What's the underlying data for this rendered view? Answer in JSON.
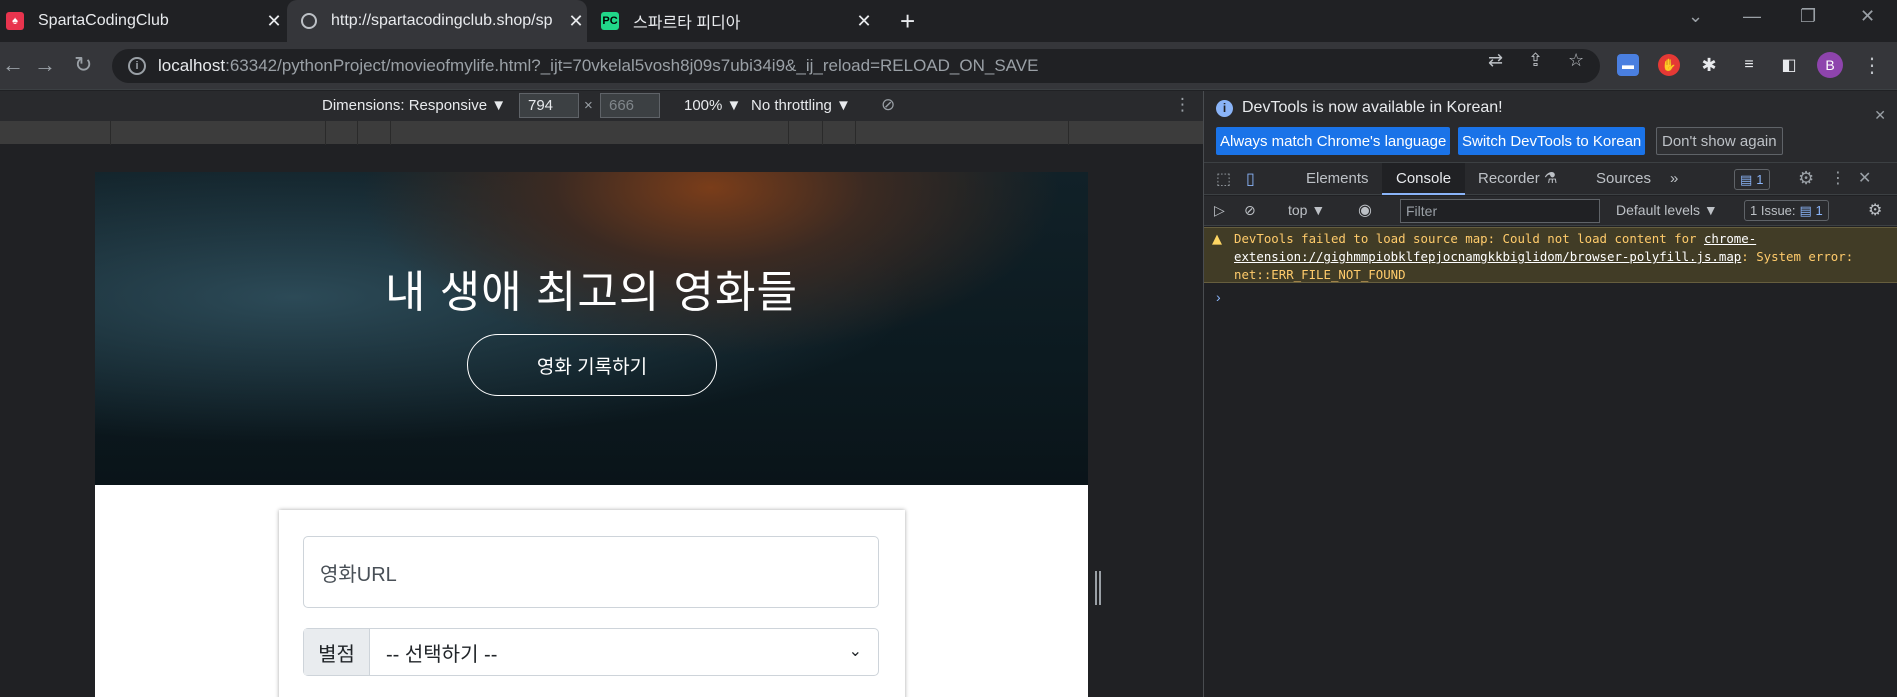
{
  "browser": {
    "tabs": [
      {
        "title": "SpartaCodingClub",
        "active": false,
        "icon": "sparta-icon"
      },
      {
        "title": "http://spartacodingclub.shop/sp",
        "active": true,
        "icon": "globe-icon"
      },
      {
        "title": "스파르타 피디아",
        "active": false,
        "icon": "pycharm-icon"
      }
    ],
    "address": {
      "host": "localhost",
      "path": ":63342/pythonProject/movieofmylife.html?_ijt=70vkelal5vosh8j09s7ubi34i9&_ij_reload=RELOAD_ON_SAVE"
    },
    "avatar_letter": "B"
  },
  "device_toolbar": {
    "dimensions": "Dimensions: Responsive ▼",
    "width": "794",
    "height": "666",
    "zoom": "100% ▼",
    "throttling": "No throttling ▼"
  },
  "page": {
    "hero_title": "내 생애 최고의 영화들",
    "record_button": "영화 기록하기",
    "url_placeholder": "영화URL",
    "star_label": "별점",
    "star_select": "-- 선택하기 --"
  },
  "devtools": {
    "info_message": "DevTools is now available in Korean!",
    "btn_match": "Always match Chrome's language",
    "btn_switch": "Switch DevTools to Korean",
    "btn_dont_show": "Don't show again",
    "tabs": [
      "Elements",
      "Console",
      "Recorder",
      "Sources"
    ],
    "issues_count": "1",
    "context": "top",
    "filter_placeholder": "Filter",
    "levels": "Default levels",
    "issue_label": "1 Issue:",
    "issue_count": "1",
    "warning": {
      "prefix": "DevTools failed to load source map: Could not load content for ",
      "link": "chrome-extension://gighmmpiobklfepjocnamgkkbiglidom/browser-polyfill.js.map",
      "suffix": ": System error: net::ERR_FILE_NOT_FOUND"
    },
    "prompt": "›"
  },
  "colors": {
    "accent_blue": "#1a73e8",
    "warning_bg": "#413c26",
    "warning_text": "#ffcb6b"
  }
}
